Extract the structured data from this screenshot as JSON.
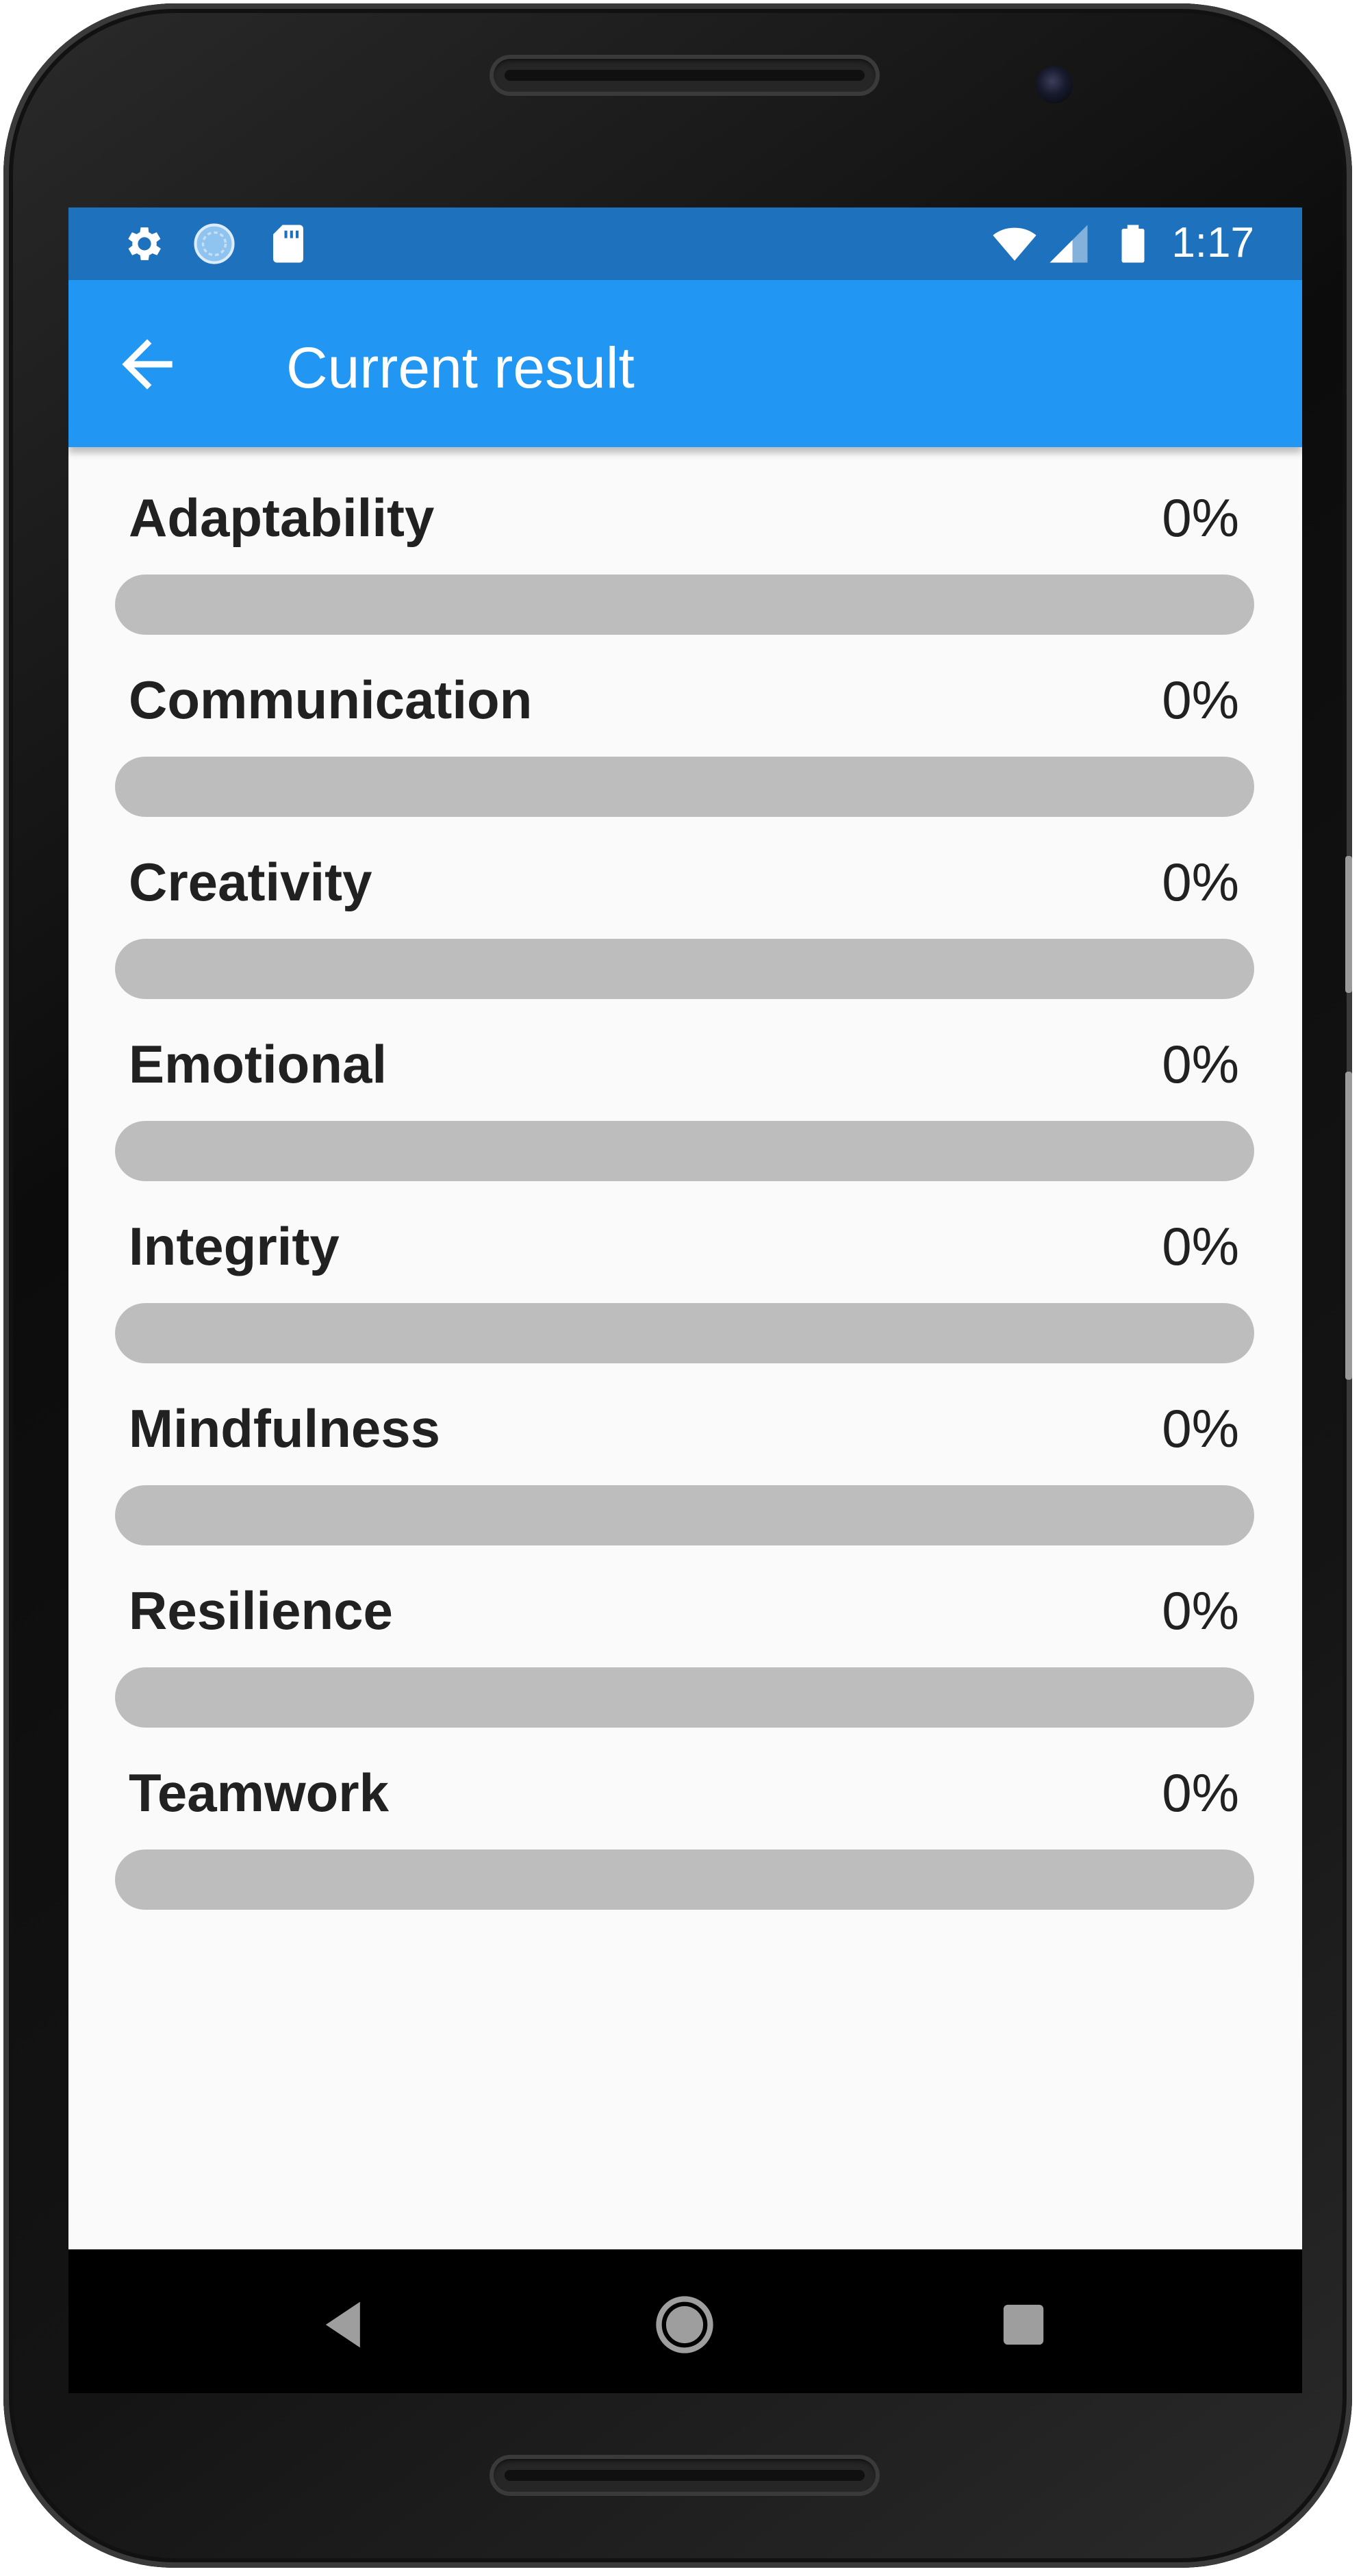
{
  "status_bar": {
    "time": "1:17",
    "icons": [
      "settings-icon",
      "sync-icon",
      "sd-card-icon",
      "wifi-icon",
      "cell-signal-icon",
      "battery-icon"
    ]
  },
  "app_bar": {
    "title": "Current result",
    "back_icon": "arrow-back-icon"
  },
  "results": {
    "items": [
      {
        "label": "Adaptability",
        "value_text": "0%",
        "progress": 0
      },
      {
        "label": "Communication",
        "value_text": "0%",
        "progress": 0
      },
      {
        "label": "Creativity",
        "value_text": "0%",
        "progress": 0
      },
      {
        "label": "Emotional",
        "value_text": "0%",
        "progress": 0
      },
      {
        "label": "Integrity",
        "value_text": "0%",
        "progress": 0
      },
      {
        "label": "Mindfulness",
        "value_text": "0%",
        "progress": 0
      },
      {
        "label": "Resilience",
        "value_text": "0%",
        "progress": 0
      },
      {
        "label": "Teamwork",
        "value_text": "0%",
        "progress": 0
      }
    ]
  },
  "nav_bar": {
    "icons": [
      "back-triangle-icon",
      "home-circle-icon",
      "recents-square-icon"
    ]
  },
  "colors": {
    "status_bar": "#1e72bd",
    "app_bar": "#2196f3",
    "track": "#bdbdbd",
    "background": "#fafafa",
    "text": "#212121"
  }
}
